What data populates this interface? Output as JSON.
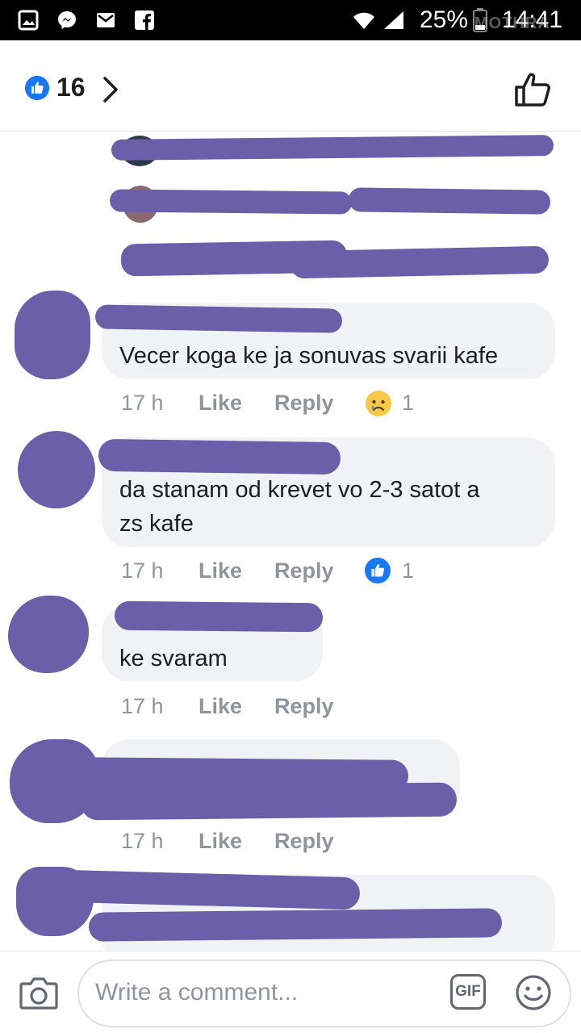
{
  "status_bar": {
    "battery": "25%",
    "time": "14:41",
    "watermark": "MOTHRA",
    "left_icons": [
      "gallery-icon",
      "messenger-icon",
      "mail-icon",
      "facebook-icon"
    ],
    "right_icons": [
      "wifi-icon",
      "signal-icon",
      "battery-icon"
    ]
  },
  "header": {
    "like_count": "16"
  },
  "comments": [
    {
      "text": "Vecer koga ke ja sonuvas svarii kafe",
      "time": "17 h",
      "like": "Like",
      "reply": "Reply",
      "reaction": "sad",
      "reaction_count": "1"
    },
    {
      "text_lines": [
        "da stanam od krevet vo 2-3 satot a",
        "zs kafe"
      ],
      "time": "17 h",
      "like": "Like",
      "reply": "Reply",
      "reaction": "like",
      "reaction_count": "1"
    },
    {
      "text": "ke svaram",
      "time": "17 h",
      "like": "Like",
      "reply": "Reply"
    },
    {
      "time": "17 h",
      "like": "Like",
      "reply": "Reply"
    }
  ],
  "composer": {
    "placeholder": "Write a comment...",
    "gif_label": "GIF"
  },
  "colors": {
    "accent": "#1877f2",
    "redaction": "#6a5fa8",
    "bubble": "#f0f2f5",
    "meta": "#90949c"
  }
}
